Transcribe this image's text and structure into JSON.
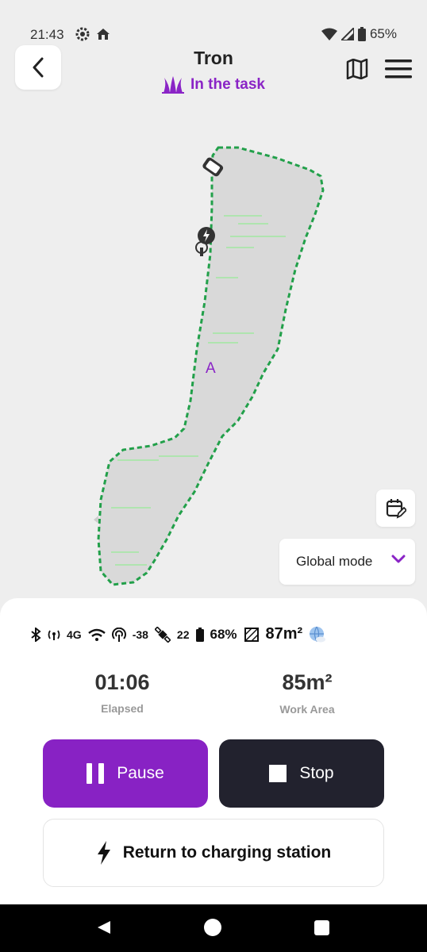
{
  "status_bar": {
    "time": "21:43",
    "battery": "65%"
  },
  "header": {
    "title": "Tron",
    "subtitle": "In the task"
  },
  "map": {
    "zone_label": "A",
    "boundary_color": "#22a04a",
    "region_color": "#d9d9d9"
  },
  "controls": {
    "mode_label": "Global mode"
  },
  "telemetry": {
    "network": "4G",
    "rtk_signal": "-38",
    "satellites": "22",
    "battery": "68%",
    "area": "87m²"
  },
  "stats": {
    "elapsed_value": "01:06",
    "elapsed_label": "Elapsed",
    "area_value": "85m²",
    "area_label": "Work Area"
  },
  "actions": {
    "pause_label": "Pause",
    "stop_label": "Stop",
    "return_label": "Return to charging station"
  },
  "colors": {
    "accent": "#8822c4",
    "dark_button": "#22222e"
  }
}
